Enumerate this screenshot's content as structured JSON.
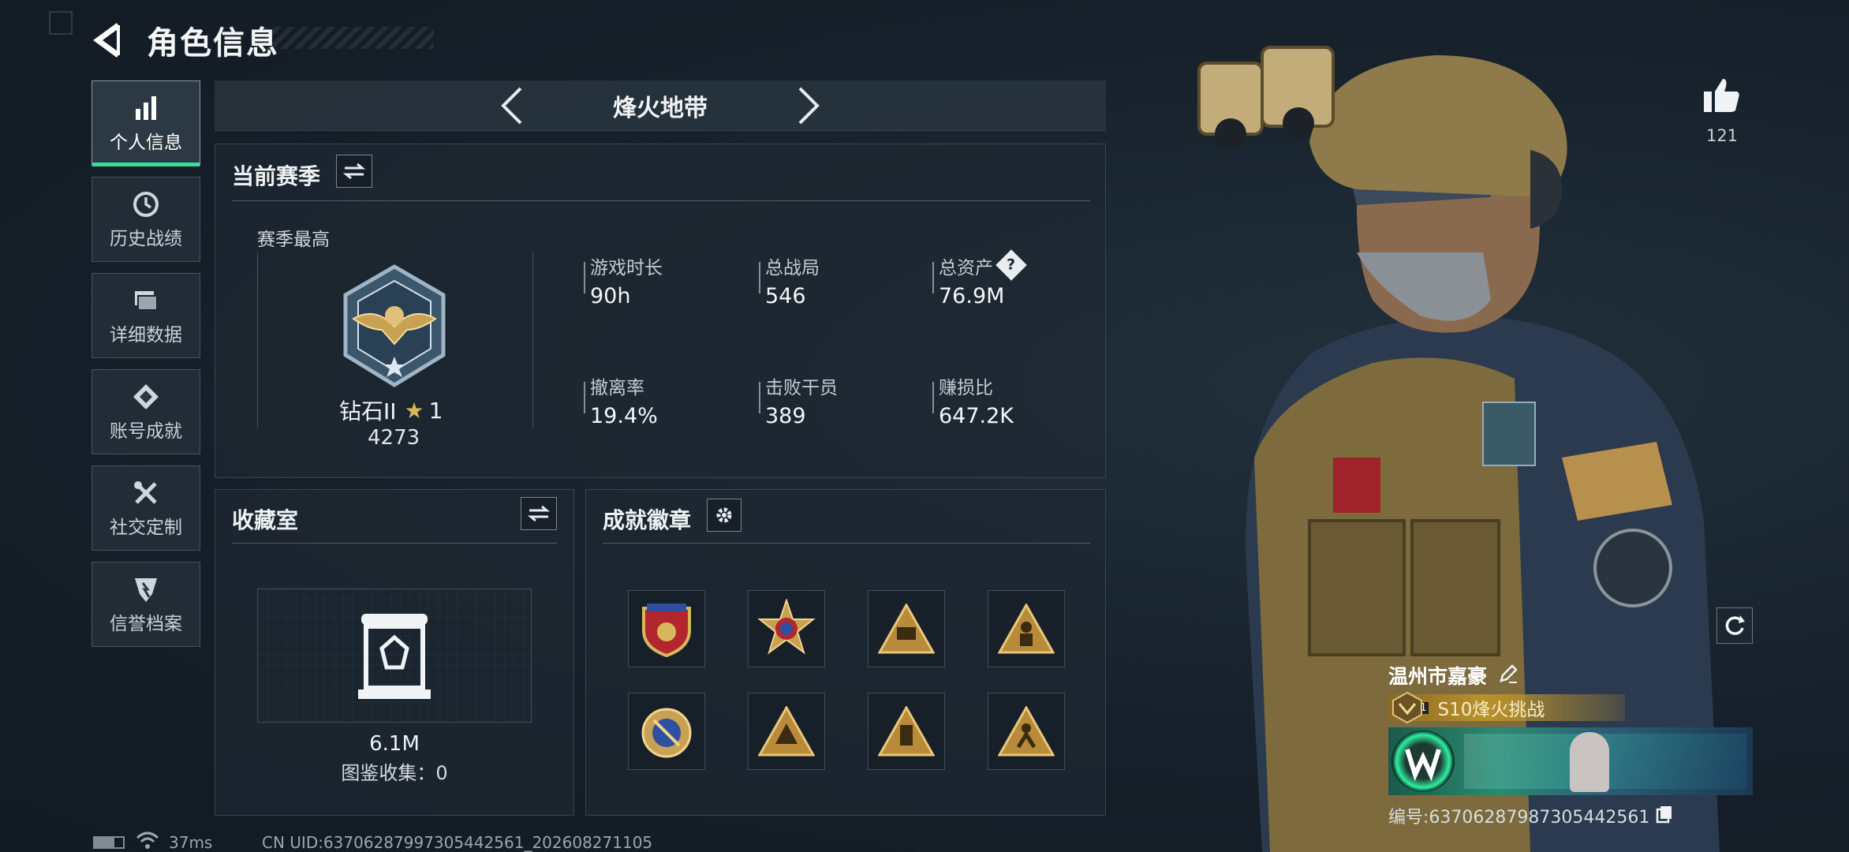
{
  "header": {
    "title": "角色信息"
  },
  "nav": {
    "items": [
      {
        "label": "个人信息",
        "icon": "bar-chart-icon",
        "active": true
      },
      {
        "label": "历史战绩",
        "icon": "history-clock-icon",
        "active": false
      },
      {
        "label": "详细数据",
        "icon": "folder-stack-icon",
        "active": false
      },
      {
        "label": "账号成就",
        "icon": "medal-icon",
        "active": false
      },
      {
        "label": "社交定制",
        "icon": "tools-icon",
        "active": false
      },
      {
        "label": "信誉档案",
        "icon": "credit-shield-icon",
        "active": false
      }
    ]
  },
  "mode": {
    "title": "烽火地带"
  },
  "season": {
    "title": "当前赛季",
    "best_label": "赛季最高",
    "rank_name": "钻石II",
    "rank_stars": "1",
    "rank_score": "4273",
    "stats": [
      {
        "label": "游戏时长",
        "value": "90h"
      },
      {
        "label": "总战局",
        "value": "546"
      },
      {
        "label": "总资产",
        "value": "76.9M",
        "help": "?"
      },
      {
        "label": "撤离率",
        "value": "19.4%"
      },
      {
        "label": "击败干员",
        "value": "389"
      },
      {
        "label": "赚损比",
        "value": "647.2K"
      }
    ]
  },
  "collection": {
    "title": "收藏室",
    "value": "6.1M",
    "catalog_label": "图鉴收集：0"
  },
  "achievements": {
    "title": "成就徽章",
    "badges": [
      {
        "icon": "shield-badge-icon"
      },
      {
        "icon": "star-medal-icon"
      },
      {
        "icon": "triangle-50-badge-icon"
      },
      {
        "icon": "triangle-figure-badge-icon"
      },
      {
        "icon": "round-crest-badge-icon"
      },
      {
        "icon": "triangle-hand-badge-icon"
      },
      {
        "icon": "triangle-bars-badge-icon"
      },
      {
        "icon": "triangle-soldier-badge-icon"
      }
    ]
  },
  "likes": {
    "count": "121"
  },
  "player": {
    "name": "温州市嘉豪",
    "level": "51",
    "challenge": "S10烽火挑战",
    "id_line": "编号:6370628798730544256​1"
  },
  "footer": {
    "ping": "37ms",
    "uid": "CN UID:6370628799730544256​1_202608271105"
  },
  "colors": {
    "accent": "#3ddc9a",
    "gold": "#b8902d",
    "bg": "#16202a"
  }
}
